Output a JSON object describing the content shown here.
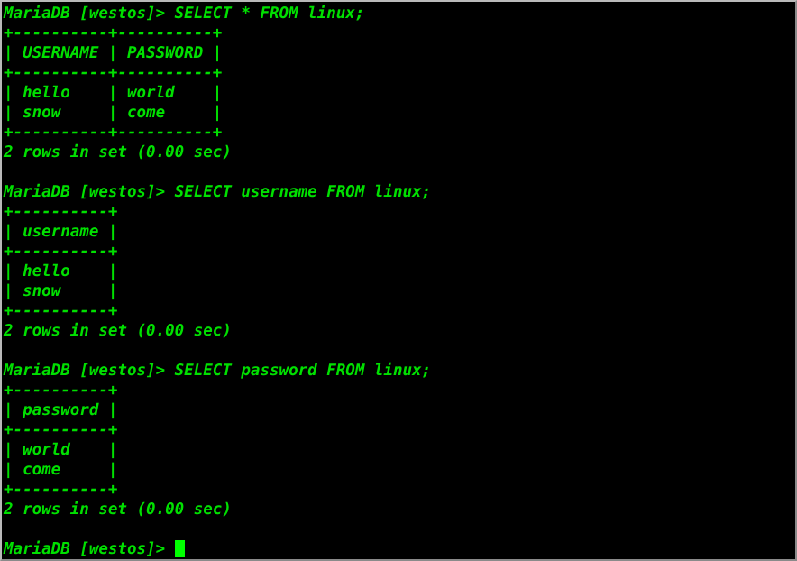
{
  "terminal": {
    "foreground_color": "#00e000",
    "background_color": "#000000",
    "cursor_color": "#00ff00",
    "border_color": "#b9b9b9",
    "prompt": "MariaDB [westos]> ",
    "database": "westos",
    "table": "linux",
    "lines": [
      "MariaDB [westos]> SELECT * FROM linux;",
      "+----------+----------+",
      "| USERNAME | PASSWORD |",
      "+----------+----------+",
      "| hello    | world    |",
      "| snow     | come     |",
      "+----------+----------+",
      "2 rows in set (0.00 sec)",
      "",
      "MariaDB [westos]> SELECT username FROM linux;",
      "+----------+",
      "| username |",
      "+----------+",
      "| hello    |",
      "| snow     |",
      "+----------+",
      "2 rows in set (0.00 sec)",
      "",
      "MariaDB [westos]> SELECT password FROM linux;",
      "+----------+",
      "| password |",
      "+----------+",
      "| world    |",
      "| come     |",
      "+----------+",
      "2 rows in set (0.00 sec)",
      ""
    ],
    "final_prompt": "MariaDB [westos]> ",
    "queries": [
      {
        "command": "SELECT * FROM linux;",
        "columns": [
          "USERNAME",
          "PASSWORD"
        ],
        "rows": [
          [
            "hello",
            "world"
          ],
          [
            "snow",
            "come"
          ]
        ],
        "status": "2 rows in set (0.00 sec)"
      },
      {
        "command": "SELECT username FROM linux;",
        "columns": [
          "username"
        ],
        "rows": [
          [
            "hello"
          ],
          [
            "snow"
          ]
        ],
        "status": "2 rows in set (0.00 sec)"
      },
      {
        "command": "SELECT password FROM linux;",
        "columns": [
          "password"
        ],
        "rows": [
          [
            "world"
          ],
          [
            "come"
          ]
        ],
        "status": "2 rows in set (0.00 sec)"
      }
    ]
  }
}
